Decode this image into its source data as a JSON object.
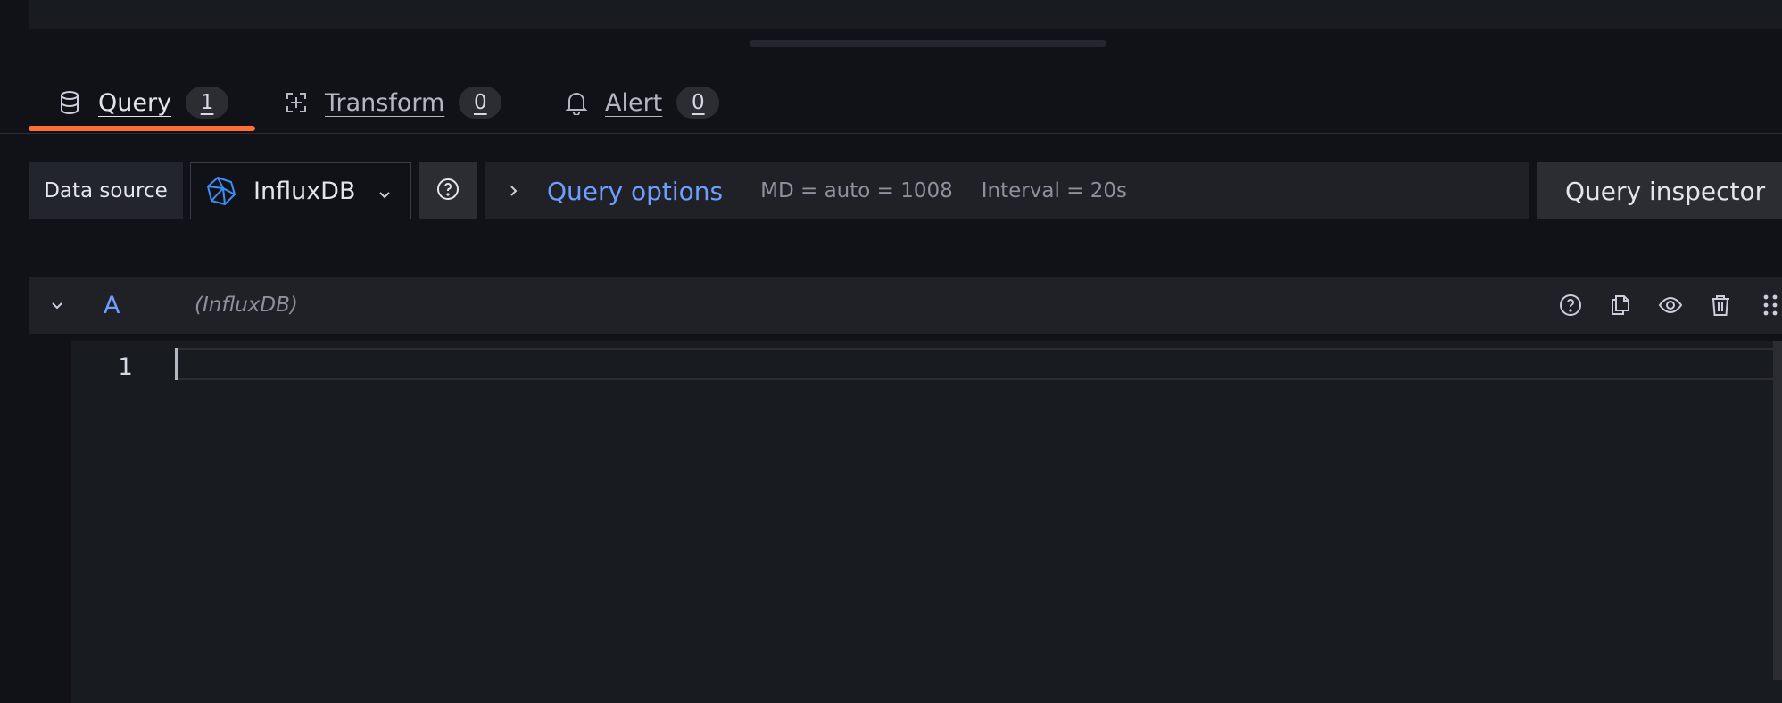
{
  "tabs": [
    {
      "label": "Query",
      "count": "1",
      "icon": "database-icon"
    },
    {
      "label": "Transform",
      "count": "0",
      "icon": "transform-icon"
    },
    {
      "label": "Alert",
      "count": "0",
      "icon": "bell-icon"
    }
  ],
  "toolbar": {
    "data_source_label": "Data source",
    "data_source_value": "InfluxDB",
    "query_options_label": "Query options",
    "md_info": "MD = auto = 1008",
    "interval_info": "Interval = 20s",
    "inspector_label": "Query inspector"
  },
  "query_row": {
    "ref_id": "A",
    "datasource": "(InfluxDB)"
  },
  "editor": {
    "line_number": "1"
  },
  "colors": {
    "accent_tab": "#ff6f31",
    "link_blue": "#6e9fff",
    "background": "#111217"
  }
}
